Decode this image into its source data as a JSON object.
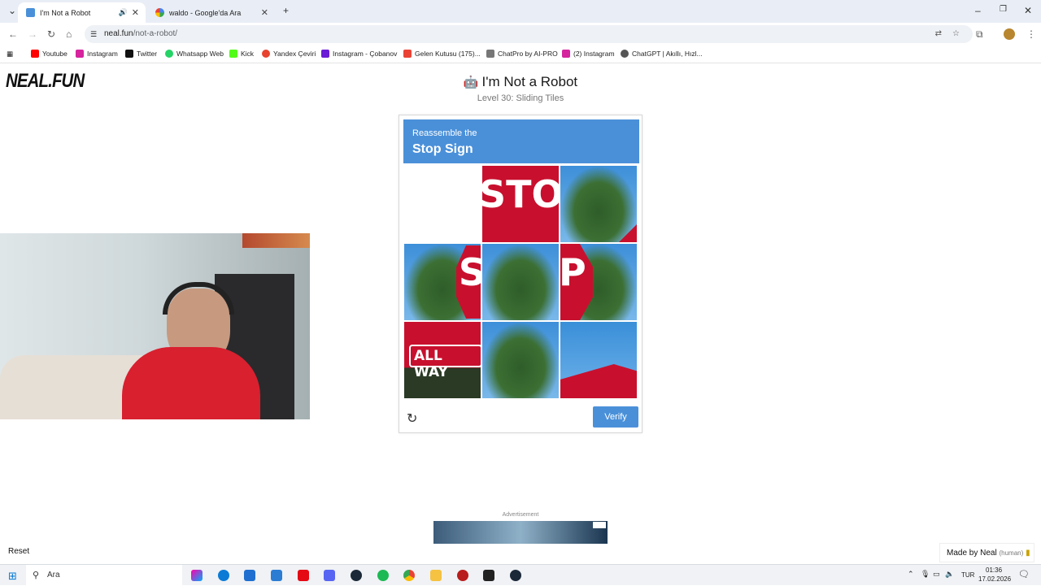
{
  "browser": {
    "tabs": [
      {
        "title": "I'm Not a Robot",
        "active": true
      },
      {
        "title": "waldo - Google'da Ara",
        "active": false
      }
    ],
    "url_host": "neal.fun",
    "url_path": "/not-a-robot/",
    "bookmarks": [
      "Youtube",
      "Instagram",
      "Twitter",
      "Whatsapp Web",
      "Kick",
      "Yandex Çeviri",
      "Instagram - Çobanov",
      "Gelen Kutusu (175)...",
      "ChatPro by AI-PRO",
      "(2) Instagram",
      "ChatGPT | Akıllı, Hızl..."
    ]
  },
  "page": {
    "logo": "NEAL.FUN",
    "title": "I'm Not a Robot",
    "subtitle": "Level 30: Sliding Tiles"
  },
  "captcha": {
    "instruction_small": "Reassemble the",
    "instruction_big": "Stop Sign",
    "tiles": [
      "STO",
      "",
      "S",
      "",
      "P",
      "ALL WAY",
      "",
      ""
    ],
    "verify_label": "Verify"
  },
  "footer": {
    "ad_label": "Advertisement",
    "reset_label": "Reset",
    "made_by": "Made by Neal",
    "made_by_tag": "(human)"
  },
  "taskbar": {
    "search_placeholder": "Ara",
    "lang": "TUR",
    "time": "01:36",
    "date": "17.02.2026"
  },
  "colors": {
    "accent": "#4a90d9",
    "stop_red": "#c8102e"
  }
}
